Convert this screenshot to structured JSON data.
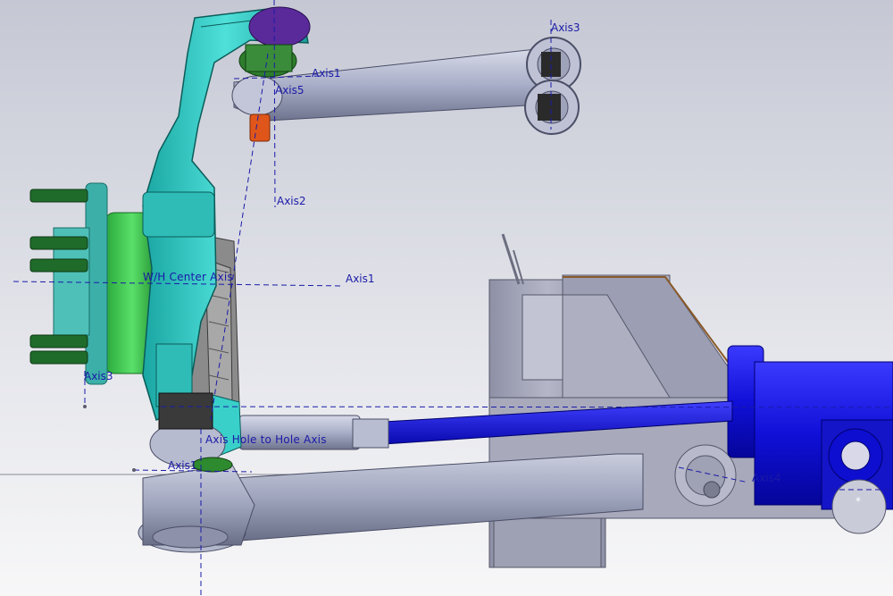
{
  "viewport": {
    "background_top": "#c6c9d5",
    "background_bottom": "#f4f4f6",
    "axis_color": "#1a1aa8"
  },
  "annotations": {
    "axis3_top": "Axis3",
    "axis1_upper": "Axis1",
    "axis5": "Axis5",
    "axis2": "Axis2",
    "wh_center_axis": "W/H Center Axis",
    "axis1_center": "Axis1",
    "axis3_left": "Axis3",
    "hole_to_hole_axis": "Axis Hole to Hole Axis",
    "axis1_lower": "Axis1",
    "axis4": "Axis4",
    "asterisk": "*"
  },
  "parts": {
    "spindle_color": "#35c9c4",
    "hub_color": "#3cc84a",
    "rotor_color": "#8a8a8a",
    "upper_arm_color": "#a9aec8",
    "lower_arm_color": "#a3a8c2",
    "tie_rod_color": "#1414d6",
    "rack_color": "#1212e0",
    "frame_color": "#9a9cb0",
    "ball_joint_color": "#2e7d2e",
    "bushing_color": "#e0561a",
    "studs_color": "#1f6b2a"
  }
}
